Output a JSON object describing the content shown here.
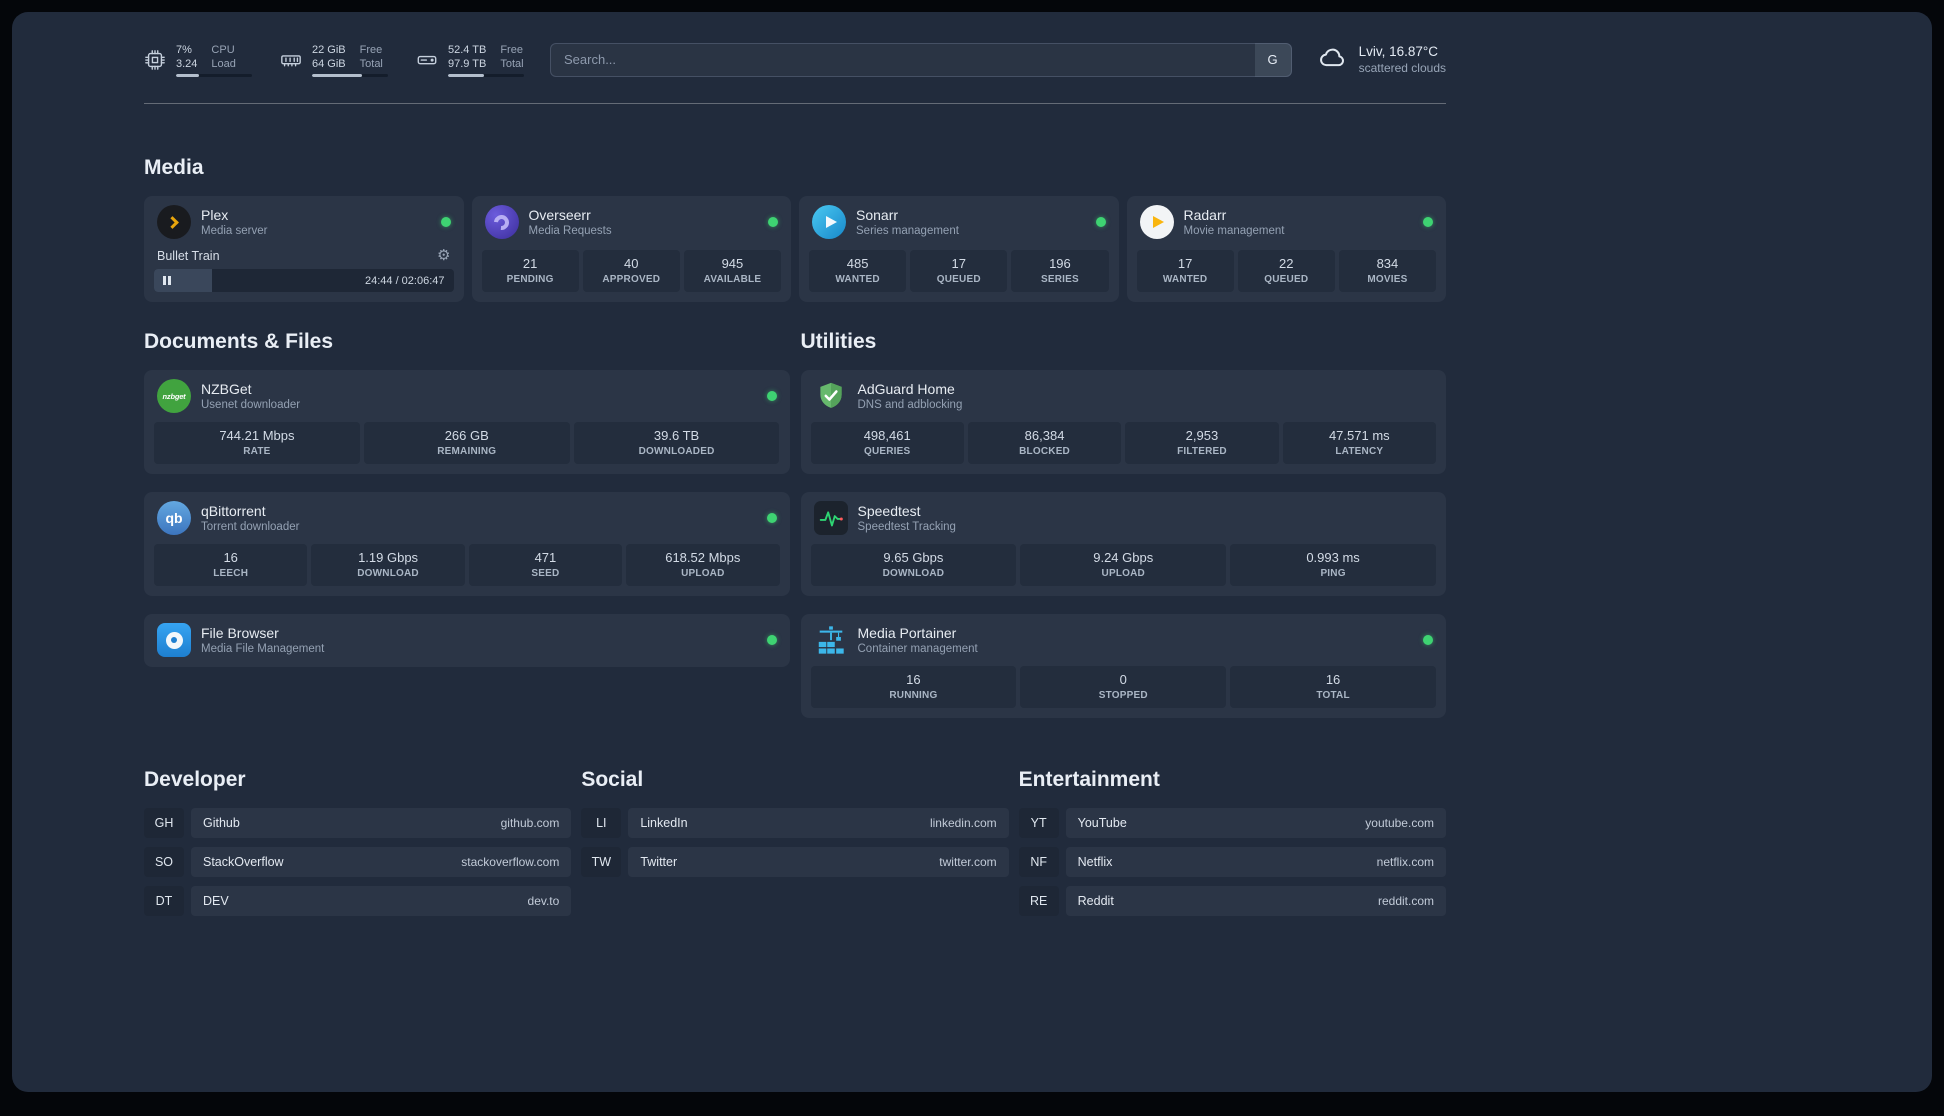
{
  "colors": {
    "status_online": "#3ed372",
    "background": "#212b3c",
    "card": "#2b3546"
  },
  "topbar": {
    "resources": [
      {
        "line1": "7%",
        "line2": "3.24",
        "label1": "CPU",
        "label2": "Load",
        "percent": 30
      },
      {
        "line1": "22 GiB",
        "line2": "64 GiB",
        "label1": "Free",
        "label2": "Total",
        "percent": 66
      },
      {
        "line1": "52.4 TB",
        "line2": "97.9 TB",
        "label1": "Free",
        "label2": "Total",
        "percent": 47
      }
    ],
    "search": {
      "placeholder": "Search...",
      "provider_label": "G"
    },
    "weather": {
      "location": "Lviv, 16.87°C",
      "condition": "scattered clouds"
    }
  },
  "sections": {
    "media": {
      "title": "Media",
      "plex": {
        "name": "Plex",
        "desc": "Media server",
        "now_playing": "Bullet Train",
        "time": "24:44 / 02:06:47",
        "progress": 19.5
      },
      "overseerr": {
        "name": "Overseerr",
        "desc": "Media Requests",
        "stats": [
          {
            "value": "21",
            "label": "PENDING"
          },
          {
            "value": "40",
            "label": "APPROVED"
          },
          {
            "value": "945",
            "label": "AVAILABLE"
          }
        ]
      },
      "sonarr": {
        "name": "Sonarr",
        "desc": "Series management",
        "stats": [
          {
            "value": "485",
            "label": "WANTED"
          },
          {
            "value": "17",
            "label": "QUEUED"
          },
          {
            "value": "196",
            "label": "SERIES"
          }
        ]
      },
      "radarr": {
        "name": "Radarr",
        "desc": "Movie management",
        "stats": [
          {
            "value": "17",
            "label": "WANTED"
          },
          {
            "value": "22",
            "label": "QUEUED"
          },
          {
            "value": "834",
            "label": "MOVIES"
          }
        ]
      }
    },
    "documents": {
      "title": "Documents & Files",
      "nzbget": {
        "name": "NZBGet",
        "desc": "Usenet downloader",
        "icon_text": "nzbget",
        "stats": [
          {
            "value": "744.21 Mbps",
            "label": "RATE"
          },
          {
            "value": "266 GB",
            "label": "REMAINING"
          },
          {
            "value": "39.6 TB",
            "label": "DOWNLOADED"
          }
        ]
      },
      "qbittorrent": {
        "name": "qBittorrent",
        "desc": "Torrent downloader",
        "icon_text": "qb",
        "stats": [
          {
            "value": "16",
            "label": "LEECH"
          },
          {
            "value": "1.19 Gbps",
            "label": "DOWNLOAD"
          },
          {
            "value": "471",
            "label": "SEED"
          },
          {
            "value": "618.52 Mbps",
            "label": "UPLOAD"
          }
        ]
      },
      "filebrowser": {
        "name": "File Browser",
        "desc": "Media File Management"
      }
    },
    "utilities": {
      "title": "Utilities",
      "adguard": {
        "name": "AdGuard Home",
        "desc": "DNS and adblocking",
        "stats": [
          {
            "value": "498,461",
            "label": "QUERIES"
          },
          {
            "value": "86,384",
            "label": "BLOCKED"
          },
          {
            "value": "2,953",
            "label": "FILTERED"
          },
          {
            "value": "47.571 ms",
            "label": "LATENCY"
          }
        ]
      },
      "speedtest": {
        "name": "Speedtest",
        "desc": "Speedtest Tracking",
        "stats": [
          {
            "value": "9.65 Gbps",
            "label": "DOWNLOAD"
          },
          {
            "value": "9.24 Gbps",
            "label": "UPLOAD"
          },
          {
            "value": "0.993 ms",
            "label": "PING"
          }
        ]
      },
      "portainer": {
        "name": "Media Portainer",
        "desc": "Container management",
        "stats": [
          {
            "value": "16",
            "label": "RUNNING"
          },
          {
            "value": "0",
            "label": "STOPPED"
          },
          {
            "value": "16",
            "label": "TOTAL"
          }
        ]
      }
    }
  },
  "bookmarks": {
    "developer": {
      "title": "Developer",
      "items": [
        {
          "abbr": "GH",
          "name": "Github",
          "domain": "github.com"
        },
        {
          "abbr": "SO",
          "name": "StackOverflow",
          "domain": "stackoverflow.com"
        },
        {
          "abbr": "DT",
          "name": "DEV",
          "domain": "dev.to"
        }
      ]
    },
    "social": {
      "title": "Social",
      "items": [
        {
          "abbr": "LI",
          "name": "LinkedIn",
          "domain": "linkedin.com"
        },
        {
          "abbr": "TW",
          "name": "Twitter",
          "domain": "twitter.com"
        }
      ]
    },
    "entertainment": {
      "title": "Entertainment",
      "items": [
        {
          "abbr": "YT",
          "name": "YouTube",
          "domain": "youtube.com"
        },
        {
          "abbr": "NF",
          "name": "Netflix",
          "domain": "netflix.com"
        },
        {
          "abbr": "RE",
          "name": "Reddit",
          "domain": "reddit.com"
        }
      ]
    }
  }
}
